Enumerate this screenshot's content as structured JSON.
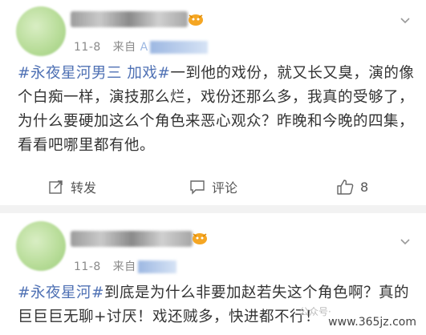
{
  "posts": [
    {
      "date": "11-8",
      "source_prefix": "来自",
      "source_visible": "A",
      "hashtag": "#永夜星河男三 加戏#",
      "text": "一到他的戏份，就又长又臭，演的像个白痴一样，演技那么烂，戏份还那么多，我真的受够了，为什么要硬加这么个角色来恶心观众？昨晚和今晚的四集，看看吧哪里都有他。",
      "actions": {
        "share": "转发",
        "comment": "评论",
        "like_count": "8"
      }
    },
    {
      "date": "11-8",
      "source_prefix": "来自",
      "hashtag": "#永夜星河#",
      "text": "到底是为什么非要加赵若失这个角色啊？真的巨巨巨无聊+讨厌！戏还贼多，快进都不行！"
    }
  ],
  "overlay": {
    "faded_text": "公众号·",
    "watermark": "www.365jz.com"
  },
  "colors": {
    "hashtag": "#4f71b4",
    "meta": "#8a8a8a",
    "background": "#f2f2f2"
  }
}
